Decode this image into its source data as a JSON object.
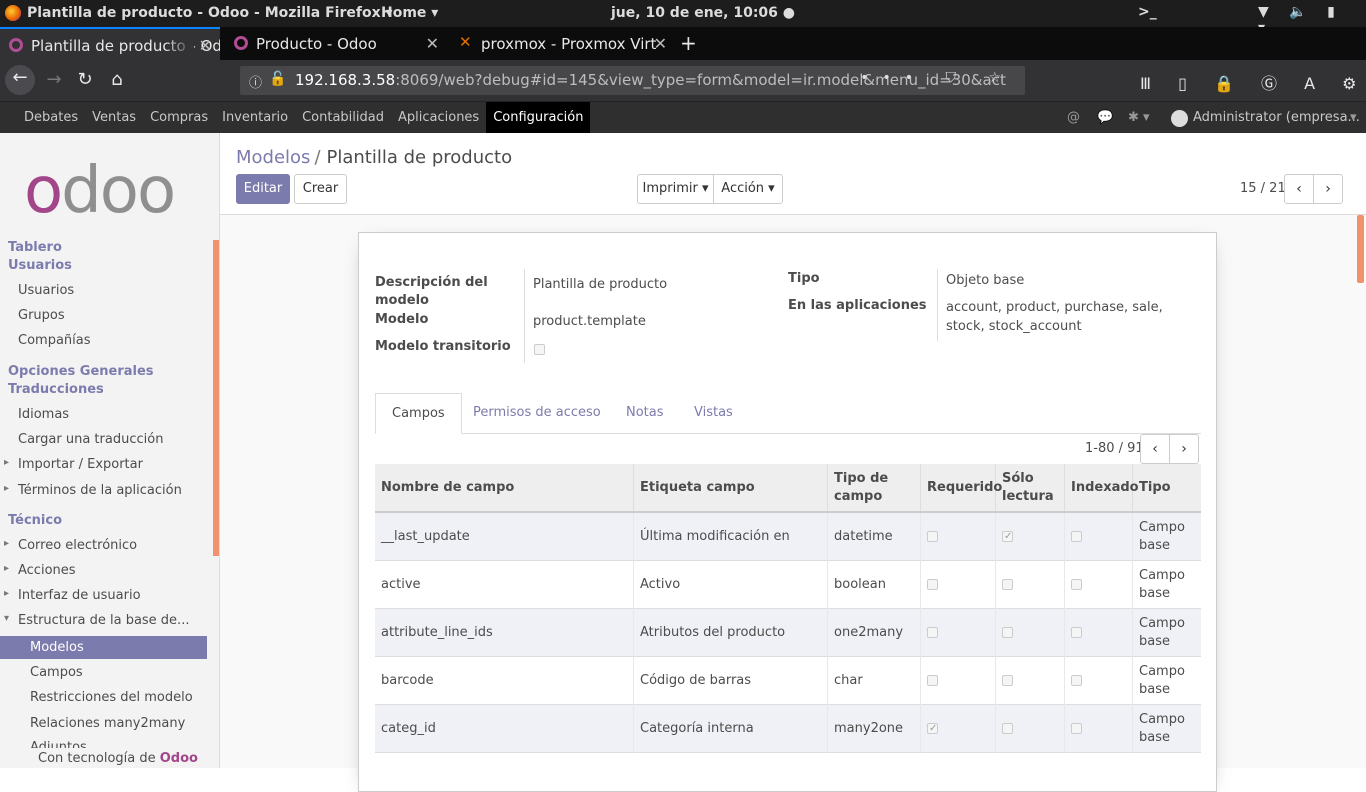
{
  "os": {
    "window_title": "Plantilla de producto - Odoo - Mozilla Firefox ▾",
    "home": "Home ▾",
    "clock": "jue, 10 de ene, 10:06 ●",
    "tray_term": ">_",
    "tray_icons": "▼ 🔈 ▮ ▾"
  },
  "browser": {
    "tabs": [
      {
        "label": "Plantilla de producto - Od",
        "icon": "odoo-tab-icon"
      },
      {
        "label": "Producto - Odoo",
        "icon": "odoo-tab-icon"
      },
      {
        "label": "proxmox - Proxmox Virt",
        "icon": "proxmox-tab-icon"
      }
    ],
    "url_host": "192.168.3.58",
    "url_rest": ":8069/web?debug#id=145&view_type=form&model=ir.model&menu_id=30&act",
    "url_actions": "••• ⛉ ☆",
    "nav_right_icons": "Ⅲ ▯ 🔒 Ⓖ A ⚙ ☰"
  },
  "odoo_menu": {
    "items": [
      "Debates",
      "Ventas",
      "Compras",
      "Inventario",
      "Contabilidad",
      "Aplicaciones",
      "Configuración"
    ],
    "active": "Configuración",
    "user": "Administrator (empresa...",
    "user_caret": "▾",
    "at_icon": "@",
    "chat_icon": "💬",
    "bug_icon": "✱ ▾"
  },
  "sidebar": {
    "logo_o": "o",
    "logo_rest": "doo",
    "head1": "Tablero",
    "head2": "Usuarios",
    "s_usuarios": "Usuarios",
    "s_grupos": "Grupos",
    "s_companias": "Compañías",
    "head3": "Opciones Generales",
    "head4": "Traducciones",
    "s_idiomas": "Idiomas",
    "s_cargar": "Cargar una traducción",
    "s_importar": "Importar / Exportar",
    "s_terminos": "Términos de la aplicación",
    "head5": "Técnico",
    "s_correo": "Correo electrónico",
    "s_acciones": "Acciones",
    "s_interfaz": "Interfaz de usuario",
    "s_estructura": "Estructura de la base de...",
    "s_modelos": "Modelos",
    "s_campos": "Campos",
    "s_restricciones": "Restricciones del modelo",
    "s_relaciones": "Relaciones many2many",
    "s_adjuntos": "Adjuntos",
    "footer_prefix": "Con tecnología de ",
    "footer_brand": "Odoo"
  },
  "header": {
    "breadcrumb_parent": "Modelos",
    "breadcrumb_sep": "/",
    "breadcrumb_current": "Plantilla de producto",
    "btn_editar": "Editar",
    "btn_crear": "Crear",
    "btn_imprimir": "Imprimir ▾",
    "btn_accion": "Acción ▾",
    "pager": "15 / 21",
    "prev": "‹",
    "next": "›"
  },
  "form": {
    "descripcion_label": "Descripción del modelo",
    "descripcion_value": "Plantilla de producto",
    "modelo_label": "Modelo",
    "modelo_value": "product.template",
    "transitorio_label": "Modelo transitorio",
    "transitorio_checked": false,
    "tipo_label": "Tipo",
    "tipo_value": "Objeto base",
    "apps_label": "En las aplicaciones",
    "apps_value_1": "account, product, purchase, sale,",
    "apps_value_2": "stock, stock_account"
  },
  "tabs": [
    "Campos",
    "Permisos de acceso",
    "Notas",
    "Vistas"
  ],
  "fields_list": {
    "pager": "1-80 / 91",
    "headers": [
      "Nombre de campo",
      "Etiqueta campo",
      "Tipo de campo",
      "Requerido",
      "Sólo lectura",
      "Indexado",
      "Tipo"
    ],
    "rows": [
      {
        "name": "__last_update",
        "label": "Última modificación en",
        "type": "datetime",
        "required": false,
        "readonly": true,
        "indexed": false,
        "kind": "Campo base"
      },
      {
        "name": "active",
        "label": "Activo",
        "type": "boolean",
        "required": false,
        "readonly": false,
        "indexed": false,
        "kind": "Campo base"
      },
      {
        "name": "attribute_line_ids",
        "label": "Atributos del producto",
        "type": "one2many",
        "required": false,
        "readonly": false,
        "indexed": false,
        "kind": "Campo base"
      },
      {
        "name": "barcode",
        "label": "Código de barras",
        "type": "char",
        "required": false,
        "readonly": false,
        "indexed": false,
        "kind": "Campo base"
      },
      {
        "name": "categ_id",
        "label": "Categoría interna",
        "type": "many2one",
        "required": true,
        "readonly": false,
        "indexed": false,
        "kind": "Campo base"
      }
    ]
  },
  "colors": {
    "accent": "#7c7bad",
    "brand": "#a24689",
    "scroll": "#f0926d"
  }
}
